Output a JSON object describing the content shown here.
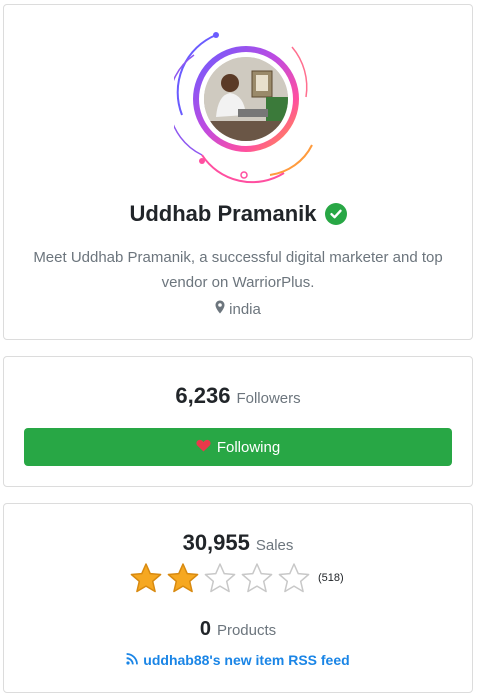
{
  "profile": {
    "name": "Uddhab Pramanik",
    "bio": "Meet Uddhab Pramanik, a successful digital marketer and top vendor on WarriorPlus.",
    "location": "india",
    "verified_color": "#28a745"
  },
  "followers": {
    "count": "6,236",
    "label": "Followers",
    "button_label": "Following",
    "button_color": "#28a745",
    "heart_color": "#e8394a"
  },
  "sales": {
    "count": "30,955",
    "label": "Sales",
    "rating": 2,
    "rating_max": 5,
    "rating_count": "(518)",
    "products_count": "0",
    "products_label": "Products",
    "rss_label": "uddhab88's new item RSS feed",
    "link_color": "#1a85e6"
  }
}
